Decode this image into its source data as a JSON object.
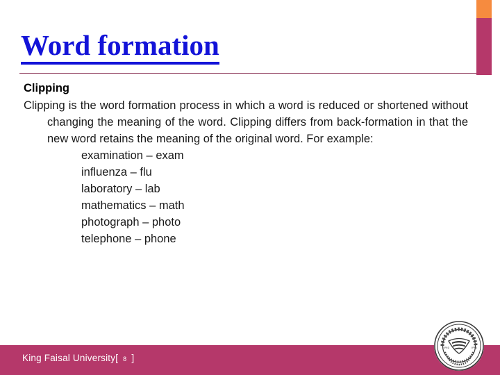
{
  "slide": {
    "title": "Word formation",
    "heading": "Clipping",
    "paragraph": "Clipping is the word formation process in which a word is reduced or shortened without changing the meaning of the word. Clipping differs from back-formation in that the new word retains the meaning of the original word. For example:",
    "examples": [
      "examination – exam",
      "influenza – flu",
      "laboratory – lab",
      "mathematics – math",
      "photograph – photo",
      "telephone – phone"
    ]
  },
  "footer": {
    "institution": "King Faisal University",
    "bracket_open": "[",
    "slide_number": "8",
    "bracket_close": "]",
    "seal_icon": "university-seal-icon"
  },
  "decor": {
    "orange_bar": "#f68b3f",
    "magenta_bar": "#b5386a",
    "rule_color": "#8e3a5c",
    "title_color": "#1313d8",
    "footer_bar_color": "#b5386a",
    "footer_text_color": "#ffffff"
  }
}
